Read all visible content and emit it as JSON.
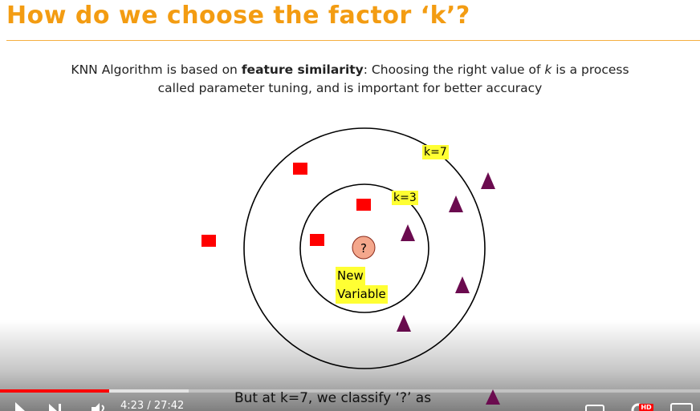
{
  "slide": {
    "title": "How do we choose the factor ‘k’?",
    "desc_part1": "KNN Algorithm is based on ",
    "desc_bold": "feature similarity",
    "desc_part2": ": Choosing the right value of ",
    "desc_k": "k",
    "desc_part3": " is a process",
    "desc_line2": "called parameter tuning, and is important for better accuracy"
  },
  "diagram": {
    "outer_label": "k=7",
    "inner_label": "k=3",
    "query_symbol": "?",
    "new_var_line1": "New",
    "new_var_line2": "Variable",
    "colors": {
      "square": "#ff0000",
      "triangle": "#6b0b4f",
      "query": "#f4a78c",
      "highlight": "#ffff33"
    }
  },
  "player": {
    "caption": "But at k=7, we classify ‘?’ as",
    "time_display": "4:23 / 27:42",
    "progress": 0.156,
    "buffered": 0.27,
    "accent": "#ff0000",
    "icons": [
      "play-icon",
      "next-icon",
      "volume-icon",
      "settings-icon",
      "hd-badge",
      "fullscreen-icon"
    ],
    "hd_label": "HD"
  }
}
